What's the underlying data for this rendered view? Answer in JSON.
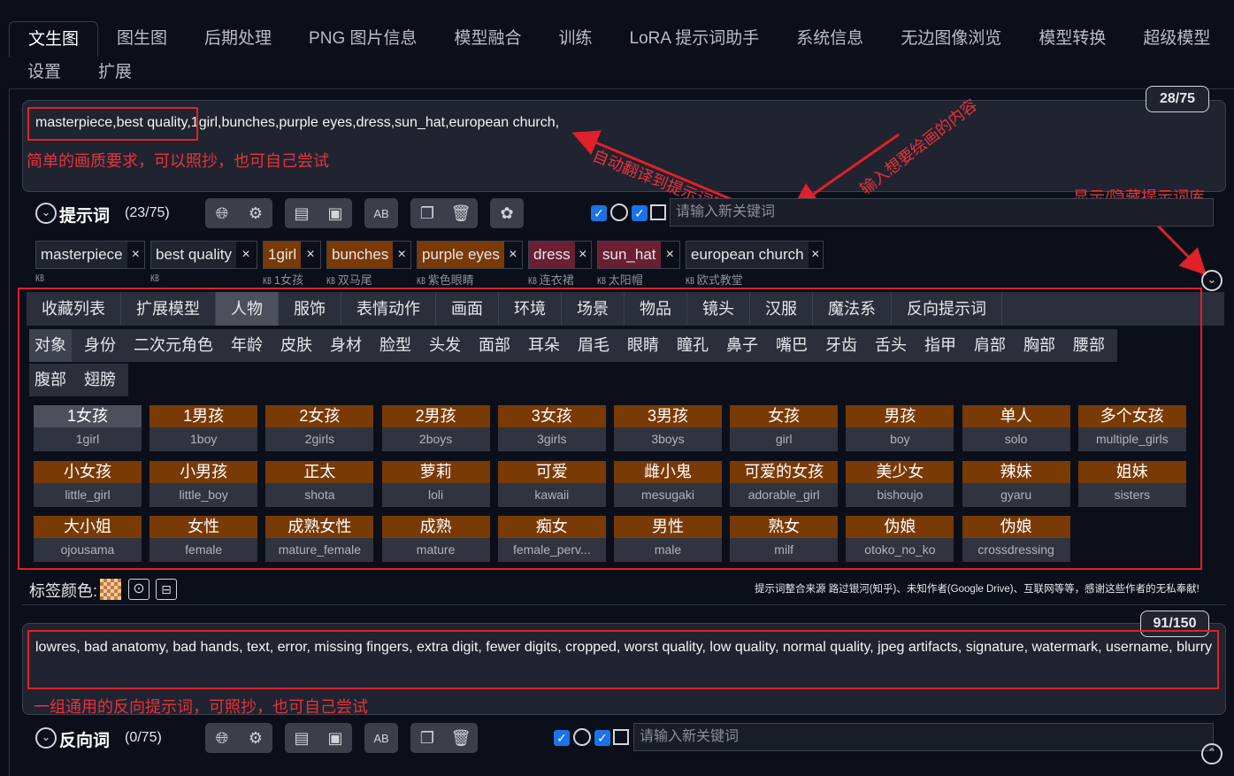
{
  "tabs_row1": [
    "文生图",
    "图生图",
    "后期处理",
    "PNG 图片信息",
    "模型融合",
    "训练",
    "LoRA 提示词助手",
    "系统信息",
    "无边图像浏览",
    "模型转换",
    "超级模型"
  ],
  "tabs_row2": [
    "设置",
    "扩展"
  ],
  "prompt": {
    "counter": "28/75",
    "text": "masterpiece,best quality,1girl,bunches,purple eyes,dress,sun_hat,european church,",
    "annotation_quality": "简单的画质要求，可以照抄，也可自己尝试",
    "annotation_translate": "自动翻译到提示词区",
    "annotation_input": "输入想要绘画的内容",
    "annotation_toggle": "显示/隐藏提示词库"
  },
  "prompt_toolbar": {
    "title": "提示词",
    "count": "(23/75)",
    "keyword_placeholder": "请输入新关键词"
  },
  "tags": [
    {
      "text": "masterpiece",
      "sub": "",
      "color": "#1f2430"
    },
    {
      "text": "best quality",
      "sub": "",
      "color": "#1f2430"
    },
    {
      "text": "1girl",
      "sub": "1女孩",
      "color": "#7a3a06"
    },
    {
      "text": "bunches",
      "sub": "双马尾",
      "color": "#7a3a06"
    },
    {
      "text": "purple eyes",
      "sub": "紫色眼睛",
      "color": "#7a3a06"
    },
    {
      "text": "dress",
      "sub": "连衣裙",
      "color": "#6b1f33"
    },
    {
      "text": "sun_hat",
      "sub": "太阳帽",
      "color": "#6b1f33"
    },
    {
      "text": "european church",
      "sub": "欧式教堂",
      "color": "#1f2430"
    }
  ],
  "categories_main": [
    "收藏列表",
    "扩展模型",
    "人物",
    "服饰",
    "表情动作",
    "画面",
    "环境",
    "场景",
    "物品",
    "镜头",
    "汉服",
    "魔法系",
    "反向提示词"
  ],
  "categories_main_active": "人物",
  "categories_sub": [
    "对象",
    "身份",
    "二次元角色",
    "年龄",
    "皮肤",
    "身材",
    "脸型",
    "头发",
    "面部",
    "耳朵",
    "眉毛",
    "眼睛",
    "瞳孔",
    "鼻子",
    "嘴巴",
    "牙齿",
    "舌头",
    "指甲",
    "肩部",
    "胸部",
    "腰部"
  ],
  "categories_sub2": [
    "腹部",
    "翅膀"
  ],
  "categories_sub_active": "对象",
  "cards": [
    {
      "zh": "1女孩",
      "en": "1girl",
      "selected": true
    },
    {
      "zh": "1男孩",
      "en": "1boy"
    },
    {
      "zh": "2女孩",
      "en": "2girls"
    },
    {
      "zh": "2男孩",
      "en": "2boys"
    },
    {
      "zh": "3女孩",
      "en": "3girls"
    },
    {
      "zh": "3男孩",
      "en": "3boys"
    },
    {
      "zh": "女孩",
      "en": "girl"
    },
    {
      "zh": "男孩",
      "en": "boy"
    },
    {
      "zh": "单人",
      "en": "solo"
    },
    {
      "zh": "多个女孩",
      "en": "multiple_girls"
    },
    {
      "zh": "小女孩",
      "en": "little_girl"
    },
    {
      "zh": "小男孩",
      "en": "little_boy"
    },
    {
      "zh": "正太",
      "en": "shota"
    },
    {
      "zh": "萝莉",
      "en": "loli"
    },
    {
      "zh": "可爱",
      "en": "kawaii"
    },
    {
      "zh": "雌小鬼",
      "en": "mesugaki"
    },
    {
      "zh": "可爱的女孩",
      "en": "adorable_girl"
    },
    {
      "zh": "美少女",
      "en": "bishoujo"
    },
    {
      "zh": "辣妹",
      "en": "gyaru"
    },
    {
      "zh": "姐妹",
      "en": "sisters"
    },
    {
      "zh": "大小姐",
      "en": "ojousama"
    },
    {
      "zh": "女性",
      "en": "female"
    },
    {
      "zh": "成熟女性",
      "en": "mature_female"
    },
    {
      "zh": "成熟",
      "en": "mature"
    },
    {
      "zh": "痴女",
      "en": "female_perv..."
    },
    {
      "zh": "男性",
      "en": "male"
    },
    {
      "zh": "熟女",
      "en": "milf"
    },
    {
      "zh": "伪娘",
      "en": "otoko_no_ko"
    },
    {
      "zh": "伪娘",
      "en": "crossdressing"
    }
  ],
  "tag_color_label": "标签颜色:",
  "credits": "提示词整合来源 路过银河(知乎)、未知作者(Google Drive)、互联网等等，感谢这些作者的无私奉献!",
  "negative": {
    "counter": "91/150",
    "text": "lowres, bad anatomy, bad hands, text, error, missing fingers, extra digit, fewer digits, cropped, worst quality, low quality, normal quality, jpeg artifacts, signature, watermark, username, blurry",
    "annotation": "一组通用的反向提示词，可照抄，也可自己尝试"
  },
  "negative_toolbar": {
    "title": "反向词",
    "count": "(0/75)",
    "keyword_placeholder": "请输入新关键词"
  },
  "colors": {
    "accent": "#e0202a",
    "tag_brown": "#7a3a06",
    "tag_red": "#6b1f33",
    "checkbox": "#1a73e8"
  }
}
